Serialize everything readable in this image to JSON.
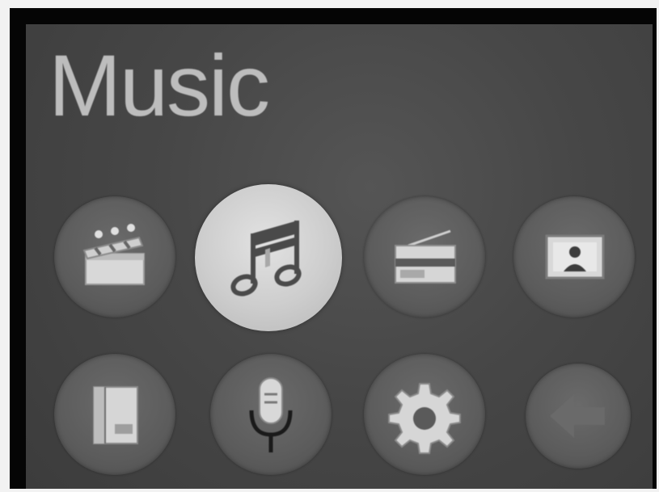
{
  "screen": {
    "title": "Music"
  },
  "menu": {
    "selected": "music",
    "icons": [
      {
        "id": "video",
        "icon": "clapperboard-icon"
      },
      {
        "id": "music",
        "icon": "music-notes-icon"
      },
      {
        "id": "radio",
        "icon": "radio-icon"
      },
      {
        "id": "photos",
        "icon": "photo-frame-icon"
      },
      {
        "id": "ebook",
        "icon": "book-icon"
      },
      {
        "id": "recorder",
        "icon": "microphone-icon"
      },
      {
        "id": "settings",
        "icon": "gear-icon"
      },
      {
        "id": "back",
        "icon": "back-arrow-icon"
      }
    ]
  },
  "colors": {
    "screen_bg": "#474747",
    "tile_bg": "#5c5c5c",
    "selected_tile_bg": "#cdcdcd",
    "title_text": "#bdbdbd"
  }
}
